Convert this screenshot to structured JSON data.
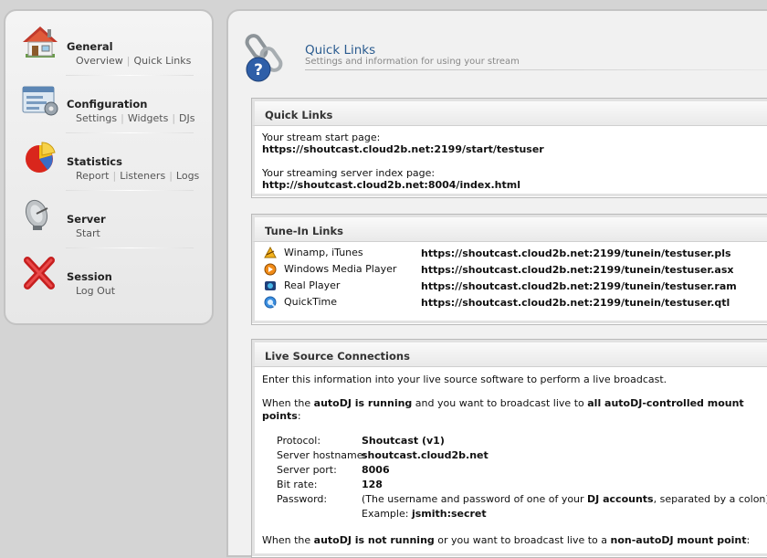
{
  "sidebar": {
    "groups": [
      {
        "title": "General",
        "links": [
          "Overview",
          "Quick Links"
        ]
      },
      {
        "title": "Configuration",
        "links": [
          "Settings",
          "Widgets",
          "DJs"
        ]
      },
      {
        "title": "Statistics",
        "links": [
          "Report",
          "Listeners",
          "Logs"
        ]
      },
      {
        "title": "Server",
        "links": [
          "Start"
        ]
      },
      {
        "title": "Session",
        "links": [
          "Log Out"
        ]
      }
    ]
  },
  "header": {
    "title": "Quick Links",
    "subtitle": "Settings and information for using your stream"
  },
  "quick_links": {
    "heading": "Quick Links",
    "start_label": "Your stream start page:",
    "start_url": "https://shoutcast.cloud2b.net:2199/start/testuser",
    "index_label": "Your streaming server index page:",
    "index_url": "http://shoutcast.cloud2b.net:8004/index.html"
  },
  "tune_in": {
    "heading": "Tune-In Links",
    "rows": [
      {
        "name": "Winamp, iTunes",
        "url": "https://shoutcast.cloud2b.net:2199/tunein/testuser.pls",
        "icon": "winamp-icon"
      },
      {
        "name": "Windows Media Player",
        "url": "https://shoutcast.cloud2b.net:2199/tunein/testuser.asx",
        "icon": "wmp-icon"
      },
      {
        "name": "Real Player",
        "url": "https://shoutcast.cloud2b.net:2199/tunein/testuser.ram",
        "icon": "realplayer-icon"
      },
      {
        "name": "QuickTime",
        "url": "https://shoutcast.cloud2b.net:2199/tunein/testuser.qtl",
        "icon": "quicktime-icon"
      }
    ]
  },
  "live": {
    "heading": "Live Source Connections",
    "intro": "Enter this information into your live source software to perform a live broadcast.",
    "autodj_on": {
      "pre": "When the ",
      "b1": "autoDJ is running",
      "mid": " and you want to broadcast live to ",
      "b2": "all autoDJ-controlled mount points",
      ":": ":"
    },
    "protocol_label": "Protocol:",
    "protocol": "Shoutcast (v1)",
    "host_label": "Server hostname:",
    "host": "shoutcast.cloud2b.net",
    "port_label": "Server port:",
    "port": "8006",
    "bitrate_label": "Bit rate:",
    "bitrate": "128",
    "password_label": "Password:",
    "password_note_pre": "(The username and password of one of your ",
    "password_note_b": "DJ accounts",
    "password_note_post": ", separated by a colon)",
    "example_label": "Example: ",
    "example": "jsmith:secret",
    "autodj_off": {
      "pre": "When the ",
      "b1": "autoDJ is not running",
      "mid": " or you want to broadcast live to a ",
      "b2": "non-autoDJ mount point",
      "end": ":"
    }
  }
}
